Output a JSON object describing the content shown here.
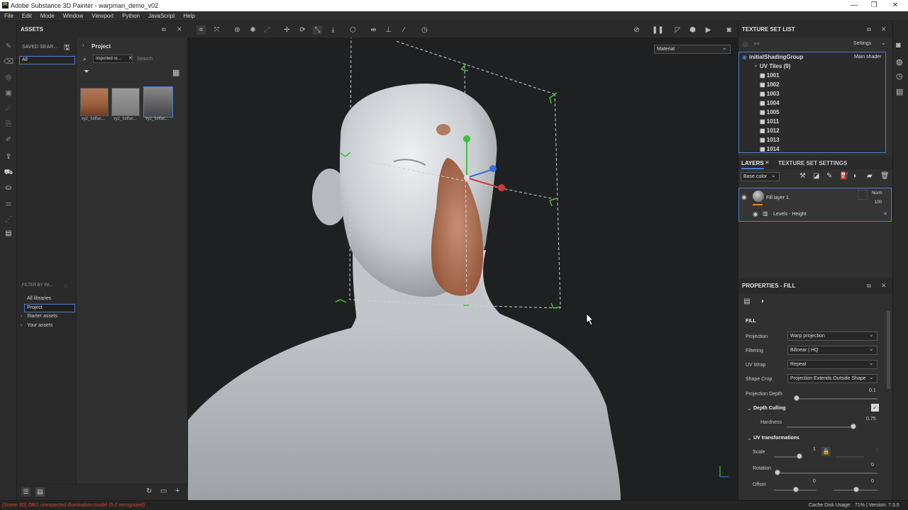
{
  "window": {
    "title": "Adobe Substance 3D Painter - warpman_demo_v02",
    "app_icon": "Pt"
  },
  "menu": [
    "File",
    "Edit",
    "Mode",
    "Window",
    "Viewport",
    "Python",
    "JavaScript",
    "Help"
  ],
  "assets": {
    "header": "ASSETS",
    "saved_searches": "SAVED SEAR...",
    "filter_value": "All",
    "breadcrumb": "Project",
    "search_chip": "Imported re...",
    "search_placeholder": "Search",
    "thumbnails": [
      {
        "label": "xyz_fullfac...",
        "tone": "#a26a48"
      },
      {
        "label": "xyz_fullfac...",
        "tone": "#8a8a8a"
      },
      {
        "label": "xyz_fullfac...",
        "tone": "#6a6a6a"
      }
    ],
    "filter_header": "FILTER BY PA...",
    "libraries": [
      "All libraries",
      "Project",
      "Starter assets",
      "Your assets"
    ]
  },
  "viewport": {
    "material_mode": "Material"
  },
  "texture_set_list": {
    "header": "TEXTURE SET LIST",
    "settings_label": "Settings",
    "group": "initialShadingGroup",
    "shader": "Main shader",
    "uv_tiles_label": "UV Tiles (9)",
    "tiles": [
      "1001",
      "1002",
      "1003",
      "1004",
      "1005",
      "1011",
      "1012",
      "1013",
      "1014"
    ]
  },
  "layers": {
    "tab_layers": "LAYERS",
    "tab_settings": "TEXTURE SET SETTINGS",
    "channel": "Base color",
    "fill_layer": "Fill layer 1",
    "blend_mode": "Norm",
    "opacity": "100",
    "effect": "Levels - Height"
  },
  "properties": {
    "header": "PROPERTIES - FILL",
    "section": "FILL",
    "projection_label": "Projection",
    "projection_value": "Warp projection",
    "filtering_label": "Filtering",
    "filtering_value": "Bilinear | HQ",
    "uvwrap_label": "UV Wrap",
    "uvwrap_value": "Repeat",
    "shapecrop_label": "Shape Crop",
    "shapecrop_value": "Projection Extends Outside Shape",
    "depth_label": "Projection Depth",
    "depth_value": "0.1",
    "depth_frac": 0.02,
    "culling_label": "Depth Culling",
    "hardness_label": "Hardness",
    "hardness_value": "0.75",
    "hardness_frac": 0.98,
    "uvtrans_label": "UV transformations",
    "scale_label": "Scale",
    "scale_value": "1",
    "rotation_label": "Rotation",
    "rotation_value": "0",
    "offset_label": "Offset",
    "offset_x": "0",
    "offset_y": "0"
  },
  "status": {
    "error": "[Scene 3D] OBJ: unexpected illumination model (0-2 recognized)",
    "cache": "Cache Disk Usage:",
    "cache_value": "71%",
    "version": "| Version: 7.3.0"
  },
  "colors": {
    "accent": "#4a7fd0",
    "error": "#d04a3a",
    "gizmo_green": "#3fbf3f"
  }
}
